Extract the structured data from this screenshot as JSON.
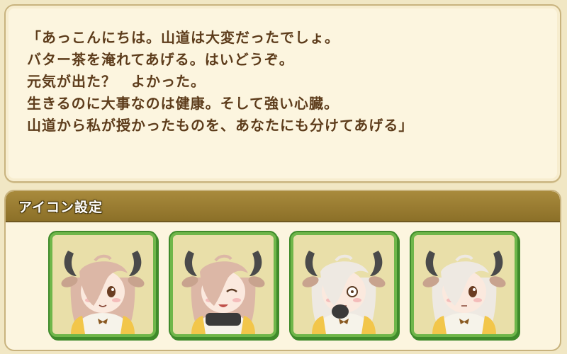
{
  "dialogue": {
    "lines": [
      "「あっこんにちは。山道は大変だったでしょ。",
      "バター茶を淹れてあげる。はいどうぞ。",
      "元気が出た？　よかった。",
      "生きるのに大事なのは健康。そして強い心臓。",
      "山道から私が授かったものを、あなたにも分けてあげる」"
    ]
  },
  "icon_settings": {
    "title": "アイコン設定",
    "icons": [
      {
        "name": "yak-portrait-smile",
        "hair_color": "#dcb7a6",
        "expression": "smile"
      },
      {
        "name": "yak-portrait-happy-cup",
        "hair_color": "#dcb7a6",
        "expression": "closed-eyes"
      },
      {
        "name": "yak-portrait-surprised",
        "hair_color": "#eee9e2",
        "expression": "surprised"
      },
      {
        "name": "yak-portrait-neutral",
        "hair_color": "#eee9e2",
        "expression": "neutral"
      }
    ]
  },
  "colors": {
    "text": "#5d3c1b",
    "header_bar": "#9c7f33",
    "frame_green": "#6fb64a"
  }
}
